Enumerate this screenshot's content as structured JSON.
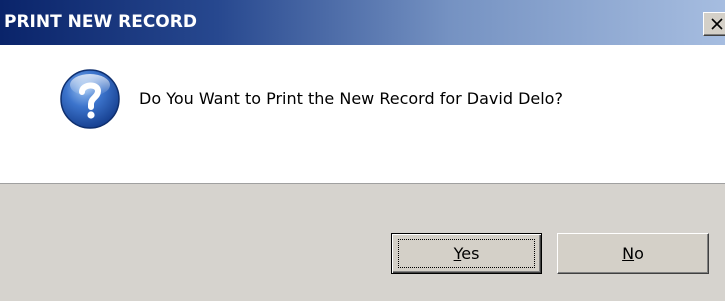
{
  "window": {
    "title": "PRINT NEW RECORD",
    "close_icon": "close-icon"
  },
  "message": {
    "icon": "question-icon",
    "text": "Do You Want to Print the New Record for David Delo?"
  },
  "buttons": {
    "yes": {
      "mnemonic": "Y",
      "rest": "es",
      "default": true
    },
    "no": {
      "mnemonic": "N",
      "rest": "o",
      "default": false
    }
  },
  "colors": {
    "titlebar_start": "#0a246a",
    "titlebar_end": "#a6bde0",
    "footer_bg": "#d6d3ce",
    "icon_blue": "#2e5fb8"
  }
}
